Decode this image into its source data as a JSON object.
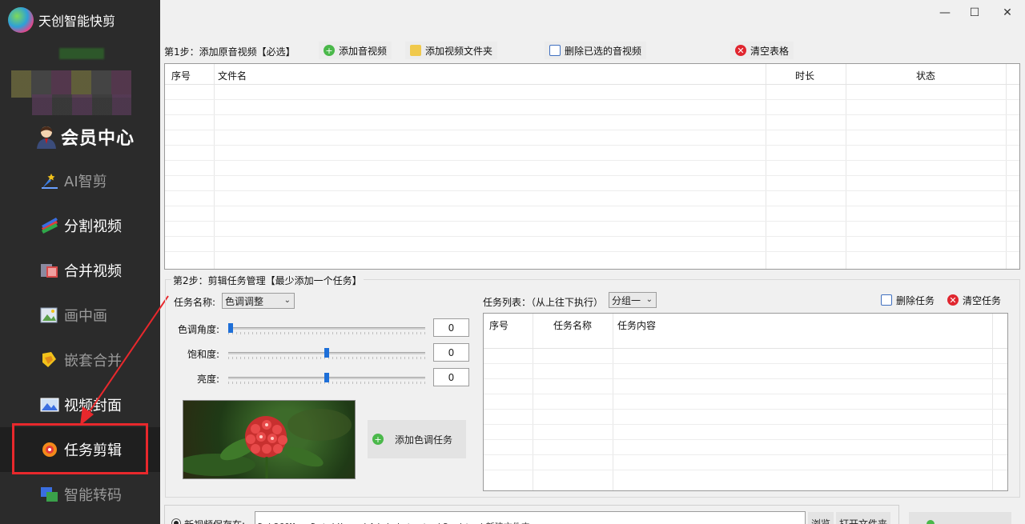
{
  "app": {
    "title": "天创智能快剪",
    "window_controls": {
      "minimize": "—",
      "maximize": "☐",
      "close": "✕"
    }
  },
  "sidebar": {
    "member_label": "会员中心",
    "items": [
      {
        "label": "AI智剪",
        "icon": "ai-cut-icon",
        "state": "dim"
      },
      {
        "label": "分割视频",
        "icon": "split-video-icon",
        "state": "normal"
      },
      {
        "label": "合并视频",
        "icon": "merge-video-icon",
        "state": "normal"
      },
      {
        "label": "画中画",
        "icon": "picture-in-picture-icon",
        "state": "dim"
      },
      {
        "label": "嵌套合并",
        "icon": "nested-merge-icon",
        "state": "dim"
      },
      {
        "label": "视频封面",
        "icon": "video-cover-icon",
        "state": "normal"
      },
      {
        "label": "任务剪辑",
        "icon": "task-edit-icon",
        "state": "active"
      },
      {
        "label": "智能转码",
        "icon": "smart-transcode-icon",
        "state": "dim"
      }
    ]
  },
  "step1": {
    "label": "第1步：添加原音视频【必选】",
    "buttons": {
      "add_media": "添加音视频",
      "add_folder": "添加视频文件夹",
      "delete_selected": "删除已选的音视频",
      "clear_table": "清空表格"
    },
    "table": {
      "columns": [
        "序号",
        "文件名",
        "时长",
        "状态"
      ],
      "rows": []
    }
  },
  "step2": {
    "label": "第2步：剪辑任务管理【最少添加一个任务】",
    "task_name_label": "任务名称:",
    "task_name_value": "色调调整",
    "sliders": [
      {
        "label": "色调角度:",
        "value": "0",
        "position": 0.0
      },
      {
        "label": "饱和度:",
        "value": "0",
        "position": 0.5
      },
      {
        "label": "亮度:",
        "value": "0",
        "position": 0.5
      }
    ],
    "add_task_button": "添加色调任务",
    "task_list_label": "任务列表：（从上往下执行）",
    "group_select": "分组一",
    "delete_task": "删除任务",
    "clear_tasks": "清空任务",
    "task_table": {
      "columns": [
        "序号",
        "任务名称",
        "任务内容"
      ],
      "rows": []
    }
  },
  "output": {
    "save_label": "新视频保存在:",
    "path": "D:\\360MoveData\\Users\\Administrator\\Desktop\\新建文件夹",
    "browse": "浏览",
    "open_folder": "打开文件夹"
  }
}
